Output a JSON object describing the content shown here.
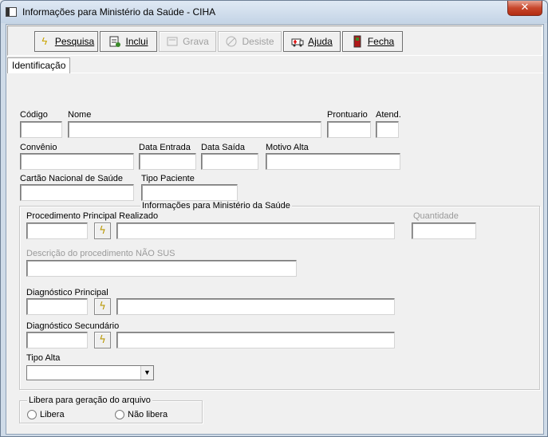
{
  "window": {
    "title": "Informações para Ministério da Saúde - CIHA",
    "close_glyph": "✕"
  },
  "toolbar": {
    "pesquisa": "Pesquisa",
    "inclui": "Inclui",
    "grava": "Grava",
    "desiste": "Desiste",
    "ajuda": "Ajuda",
    "fecha": "Fecha"
  },
  "tabs": {
    "identificacao": "Identificação"
  },
  "form": {
    "codigo": {
      "label": "Código",
      "value": ""
    },
    "nome": {
      "label": "Nome",
      "value": ""
    },
    "prontuario": {
      "label": "Prontuario",
      "value": ""
    },
    "atend": {
      "label": "Atend.",
      "value": ""
    },
    "convenio": {
      "label": "Convênio",
      "value": ""
    },
    "data_entrada": {
      "label": "Data Entrada",
      "value": ""
    },
    "data_saida": {
      "label": "Data Saída",
      "value": ""
    },
    "motivo_alta": {
      "label": "Motivo Alta",
      "value": ""
    },
    "cartao_nacional": {
      "label": "Cartão Nacional de Saúde",
      "value": ""
    },
    "tipo_paciente": {
      "label": "Tipo Paciente",
      "value": ""
    }
  },
  "ministerio_group": {
    "title": "Informações para Ministério da Saúde",
    "procedimento": {
      "label": "Procedimento Principal Realizado",
      "code": "",
      "description": ""
    },
    "quantidade": {
      "label": "Quantidade",
      "value": ""
    },
    "descricao_nao_sus": {
      "label": "Descrição do procedimento NÃO SUS",
      "value": ""
    },
    "diag_principal": {
      "label": "Diagnóstico Principal",
      "code": "",
      "description": ""
    },
    "diag_secundario": {
      "label": "Diagnóstico Secundário",
      "code": "",
      "description": ""
    },
    "tipo_alta": {
      "label": "Tipo Alta",
      "selected": ""
    }
  },
  "libera_group": {
    "title": "Libera para geração do arquivo",
    "options": [
      "Libera",
      "Não libera"
    ]
  },
  "icons": {
    "lookup": "lightning-icon",
    "lookup_glyph": "ϟ"
  }
}
